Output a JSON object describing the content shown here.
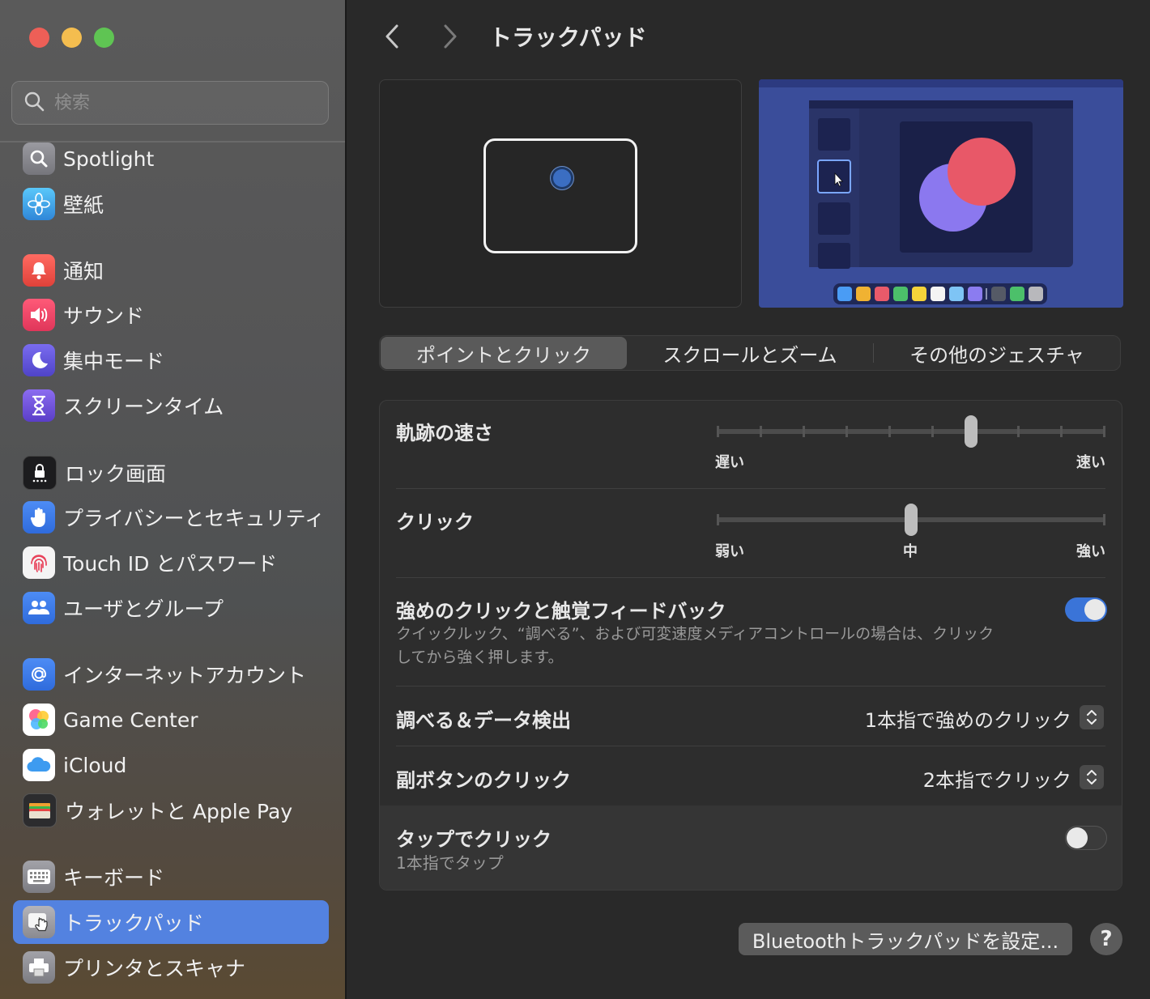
{
  "window": {
    "title": "トラックパッド"
  },
  "search": {
    "placeholder": "検索"
  },
  "sidebar": {
    "items": [
      {
        "label": "Spotlight",
        "icon": "spotlight-icon",
        "color": "#8e8e93"
      },
      {
        "label": "壁紙",
        "icon": "wallpaper-icon",
        "color": "#34aadc"
      },
      {
        "label": "通知",
        "icon": "bell-icon",
        "color": "#ef4b4b"
      },
      {
        "label": "サウンド",
        "icon": "speaker-icon",
        "color": "#ef4b6b"
      },
      {
        "label": "集中モード",
        "icon": "moon-icon",
        "color": "#5e5ce6"
      },
      {
        "label": "スクリーンタイム",
        "icon": "hourglass-icon",
        "color": "#6e59d8"
      },
      {
        "label": "ロック画面",
        "icon": "lock-icon",
        "color": "#1c1c1e"
      },
      {
        "label": "プライバシーとセキュリティ",
        "icon": "hand-icon",
        "color": "#3d7cf0"
      },
      {
        "label": "Touch ID とパスワード",
        "icon": "fingerprint-icon",
        "color": "#f2f2f2"
      },
      {
        "label": "ユーザとグループ",
        "icon": "users-icon",
        "color": "#3d7cf0"
      },
      {
        "label": "インターネットアカウント",
        "icon": "at-icon",
        "color": "#3d7cf0"
      },
      {
        "label": "Game Center",
        "icon": "game-center-icon",
        "color": "#ffffff"
      },
      {
        "label": "iCloud",
        "icon": "cloud-icon",
        "color": "#ffffff"
      },
      {
        "label": "ウォレットと Apple Pay",
        "icon": "wallet-icon",
        "color": "#2c2c2e"
      },
      {
        "label": "キーボード",
        "icon": "keyboard-icon",
        "color": "#8e8e93"
      },
      {
        "label": "トラックパッド",
        "icon": "trackpad-icon",
        "color": "#8e8e93",
        "selected": true
      },
      {
        "label": "プリンタとスキャナ",
        "icon": "printer-icon",
        "color": "#8e8e93"
      }
    ]
  },
  "tabs": [
    {
      "label": "ポイントとクリック",
      "active": true
    },
    {
      "label": "スクロールとズーム",
      "active": false
    },
    {
      "label": "その他のジェスチャ",
      "active": false
    }
  ],
  "settings": {
    "tracking": {
      "label": "軌跡の速さ",
      "min_label": "遅い",
      "max_label": "速い",
      "value": 0.66,
      "ticks": 10
    },
    "click": {
      "label": "クリック",
      "min_label": "弱い",
      "mid_label": "中",
      "max_label": "強い",
      "value": 0.5
    },
    "force_click": {
      "label": "強めのクリックと触覚フィードバック",
      "description_line1": "クイックルック、“調べる”、および可変速度メディアコントロールの場合は、クリック",
      "description_line2": "してから強く押します。",
      "enabled": true
    },
    "lookup": {
      "label": "調べる＆データ検出",
      "value": "1本指で強めのクリック"
    },
    "secondary_click": {
      "label": "副ボタンのクリック",
      "value": "2本指でクリック"
    },
    "tap_to_click": {
      "label": "タップでクリック",
      "sublabel": "1本指でタップ",
      "enabled": false
    }
  },
  "footer": {
    "bluetooth_button": "Bluetoothトラックパッドを設定...",
    "help_button": "?"
  },
  "colors": {
    "accent": "#3a74d8",
    "selection": "#5382e0"
  }
}
